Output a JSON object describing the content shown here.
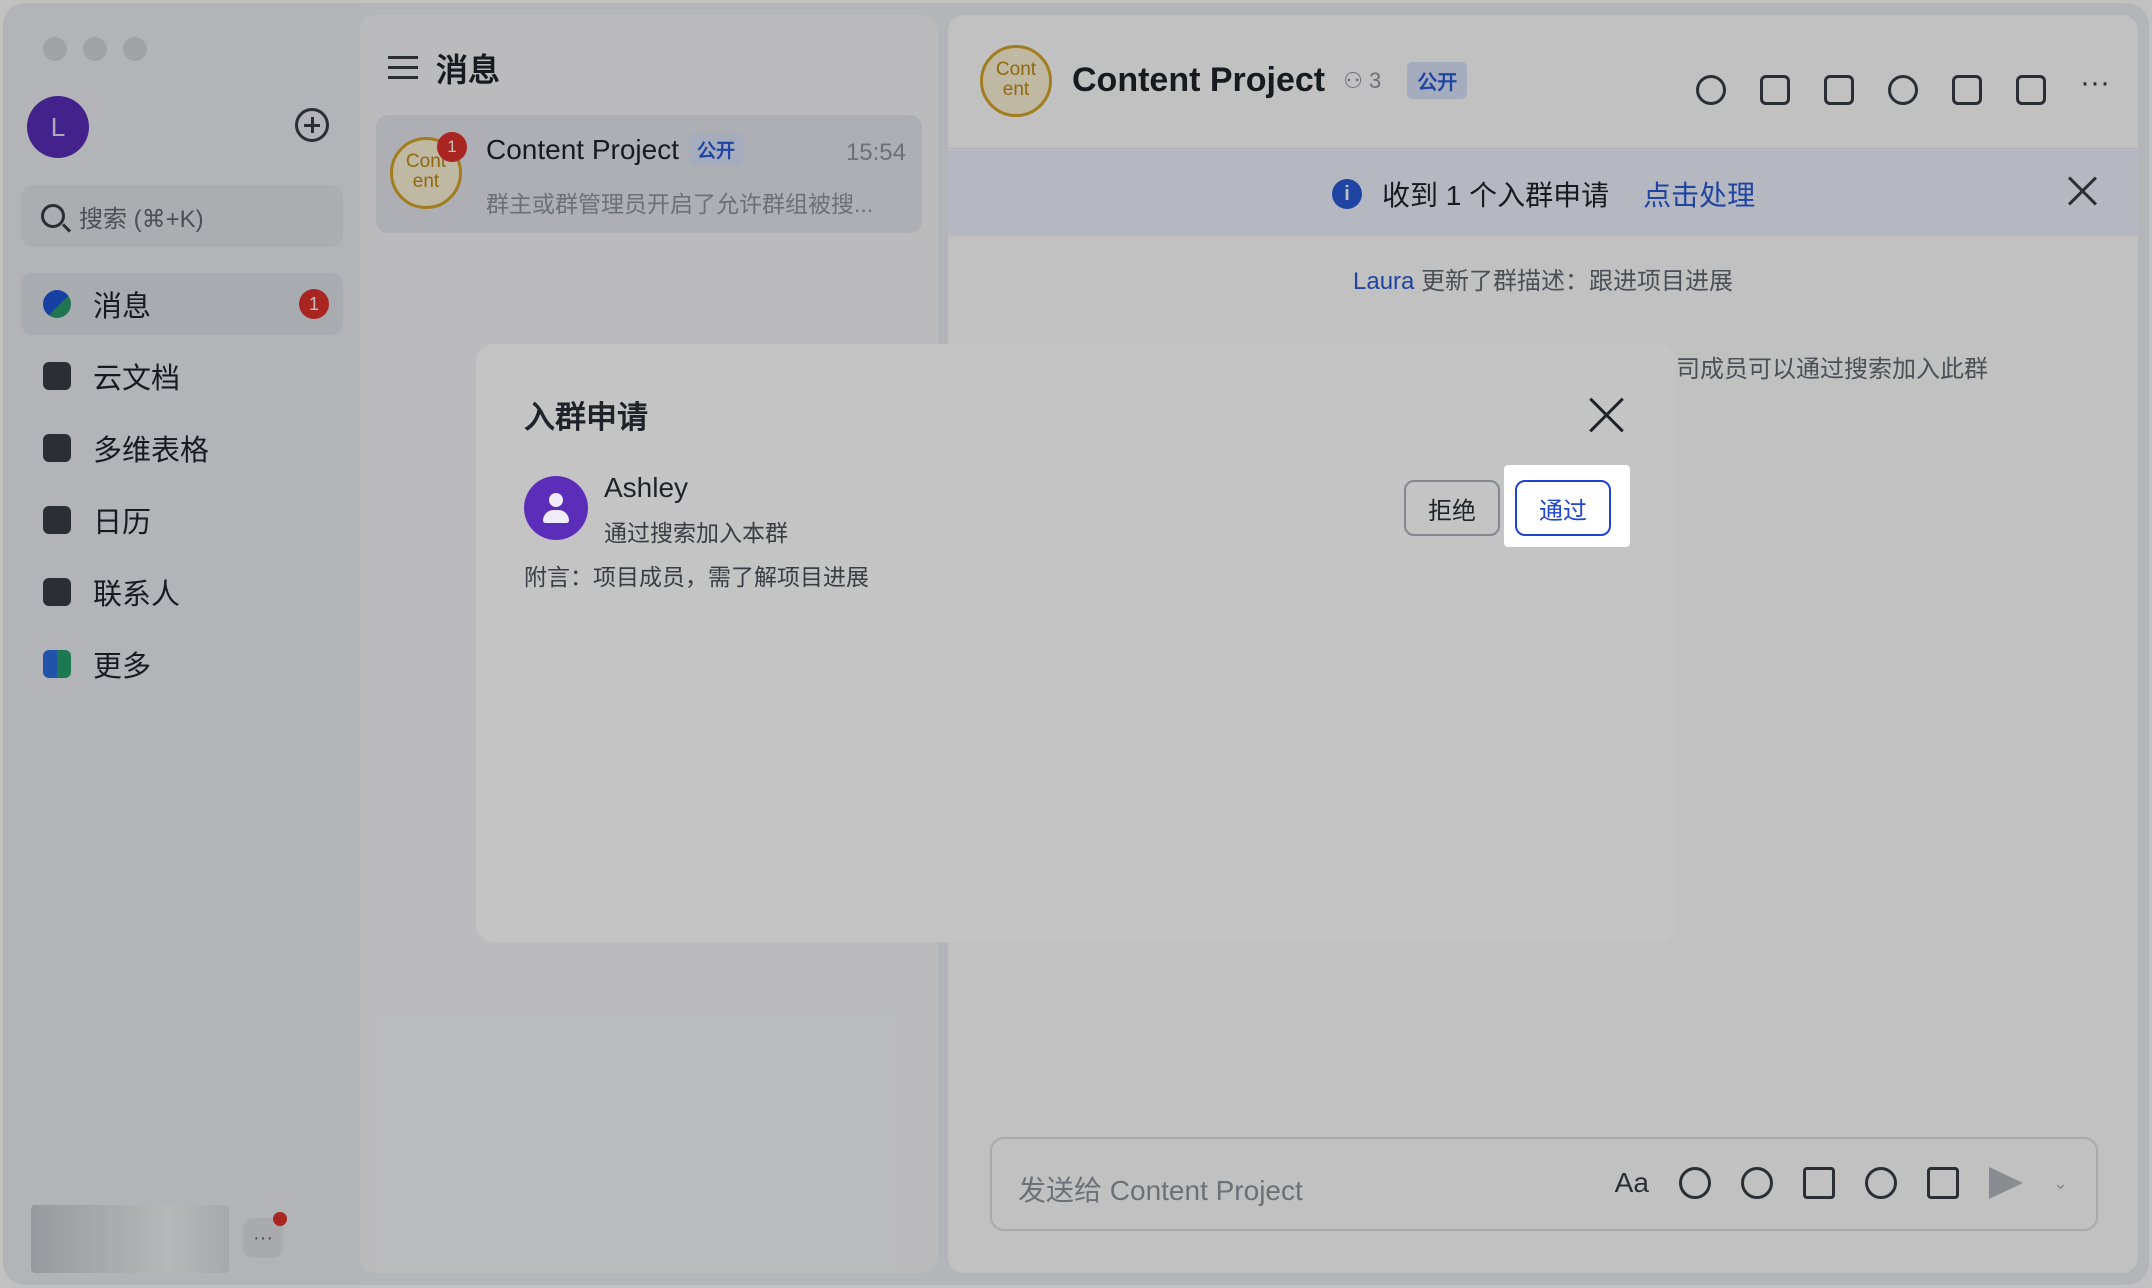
{
  "nav": {
    "avatar_letter": "L",
    "search_placeholder": "搜索 (⌘+K)",
    "items": [
      {
        "label": "消息",
        "badge": "1"
      },
      {
        "label": "云文档"
      },
      {
        "label": "多维表格"
      },
      {
        "label": "日历"
      },
      {
        "label": "联系人"
      },
      {
        "label": "更多"
      }
    ],
    "bottom_more": "···"
  },
  "list": {
    "title": "消息",
    "chat": {
      "avatar_text_1": "Cont",
      "avatar_text_2": "ent",
      "badge": "1",
      "title": "Content Project",
      "tag": "公开",
      "time": "15:54",
      "preview": "群主或群管理员开启了允许群组被搜..."
    }
  },
  "conversation": {
    "avatar_text_1": "Cont",
    "avatar_text_2": "ent",
    "title": "Content Project",
    "member_count": "3",
    "tag": "公开",
    "notice_text": "收到 1 个入群申请",
    "notice_link": "点击处理",
    "info_icon": "i",
    "sys_who": "Laura",
    "sys_text": " 更新了群描述：跟进项目进展",
    "sys_text_2": "司成员可以通过搜索加入此群",
    "composer_placeholder": "发送给 Content Project",
    "aa_label": "Aa",
    "send_chevron": "⌄"
  },
  "dialog": {
    "title": "入群申请",
    "requester_name": "Ashley",
    "requester_method": "通过搜索加入本群",
    "note": "附言：项目成员，需了解项目进展",
    "reject_label": "拒绝",
    "approve_label": "通过"
  }
}
